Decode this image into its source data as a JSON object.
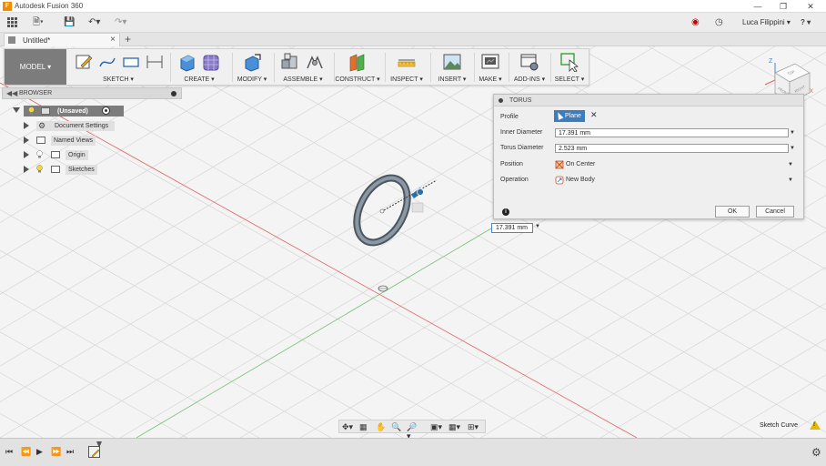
{
  "app": {
    "title": "Autodesk Fusion 360",
    "logo_letter": "F"
  },
  "quick_access": {
    "user": "Luca Filippini ▾",
    "help": "? ▾"
  },
  "tabs": [
    {
      "label": "Untitled*"
    }
  ],
  "ribbon": {
    "workspace": "MODEL ▾",
    "groups": [
      {
        "label": "SKETCH ▾"
      },
      {
        "label": "CREATE ▾"
      },
      {
        "label": "MODIFY ▾"
      },
      {
        "label": "ASSEMBLE ▾"
      },
      {
        "label": "CONSTRUCT ▾"
      },
      {
        "label": "INSPECT ▾"
      },
      {
        "label": "INSERT ▾"
      },
      {
        "label": "MAKE ▾"
      },
      {
        "label": "ADD-INS ▾"
      },
      {
        "label": "SELECT ▾"
      }
    ]
  },
  "browser": {
    "title": "BROWSER",
    "root": "(Unsaved)",
    "items": [
      {
        "label": "Document Settings"
      },
      {
        "label": "Named Views"
      },
      {
        "label": "Origin"
      },
      {
        "label": "Sketches"
      }
    ]
  },
  "torus_dialog": {
    "title": "TORUS",
    "profile_label": "Profile",
    "profile_value": "Plane",
    "inner_diameter_label": "Inner Diameter",
    "inner_diameter_value": "17.391 mm",
    "torus_diameter_label": "Torus Diameter",
    "torus_diameter_value": "2.523 mm",
    "position_label": "Position",
    "position_value": "On Center",
    "operation_label": "Operation",
    "operation_value": "New Body",
    "ok_label": "OK",
    "cancel_label": "Cancel"
  },
  "dimension_input": "17.391 mm",
  "status": {
    "text": "Sketch Curve"
  },
  "viewcube": {
    "top": "TOP",
    "front": "FRONT",
    "right": "RIGHT",
    "axis_z": "Z",
    "axis_x": "X"
  },
  "colors": {
    "accent": "#3d7dbf",
    "model_button": "#7c7c7c",
    "torus": "#6d7a86",
    "x_axis": "#e06060",
    "y_axis": "#70c070"
  }
}
